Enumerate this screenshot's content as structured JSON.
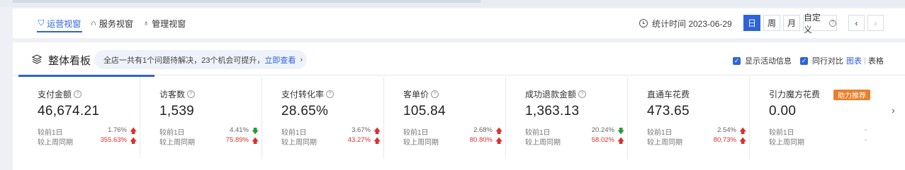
{
  "tabs": [
    {
      "label": "运营视窗",
      "icon": "shield-icon",
      "active": true
    },
    {
      "label": "服务视窗",
      "icon": "headset-icon",
      "active": false
    },
    {
      "label": "管理视窗",
      "icon": "bulb-icon",
      "active": false
    }
  ],
  "stat_time": "统计时间 2023-06-29",
  "periods": [
    "日",
    "周",
    "月",
    "自定义"
  ],
  "custom_help": "?",
  "prev_icon": "chevron-left-icon",
  "next_icon": "chevron-right-icon",
  "panel": {
    "title": "整体看板",
    "notice_text": "全店一共有1个问题待解决，23个机会可提升，",
    "notice_link": "立即查看",
    "show_activity": "显示活动信息",
    "peer_compare": "同行对比",
    "view_chart": "图表",
    "view_sep": "|",
    "view_table": "表格"
  },
  "row_labels": {
    "day": "较前1日",
    "week": "较上周同期"
  },
  "cards": [
    {
      "label": "支付金额",
      "value": "46,674.21",
      "day_pct": "1.76%",
      "day_dir": "up",
      "week_pct": "355.63%",
      "week_dir": "up"
    },
    {
      "label": "访客数",
      "value": "1,539",
      "day_pct": "4.41%",
      "day_dir": "down",
      "week_pct": "75.89%",
      "week_dir": "up"
    },
    {
      "label": "支付转化率",
      "value": "28.65%",
      "day_pct": "3.67%",
      "day_dir": "up",
      "week_pct": "43.27%",
      "week_dir": "up"
    },
    {
      "label": "客单价",
      "value": "105.84",
      "day_pct": "2.68%",
      "day_dir": "up",
      "week_pct": "80.80%",
      "week_dir": "up"
    },
    {
      "label": "成功退款金额",
      "value": "1,363.13",
      "day_pct": "20.24%",
      "day_dir": "down",
      "week_pct": "58.02%",
      "week_dir": "up"
    },
    {
      "label": "直通车花费",
      "value": "473.65",
      "day_pct": "2.54%",
      "day_dir": "up",
      "week_pct": "80.73%",
      "week_dir": "up"
    },
    {
      "label": "引力魔方花费",
      "value": "0.00",
      "day_pct": "-",
      "day_dir": "none",
      "week_pct": "-",
      "week_dir": "none"
    }
  ],
  "badge": "助力推荐",
  "colors": {
    "accent": "#2d64d6",
    "up": "#d9302e",
    "down": "#2a9b3a",
    "badge": "#e8802b"
  }
}
